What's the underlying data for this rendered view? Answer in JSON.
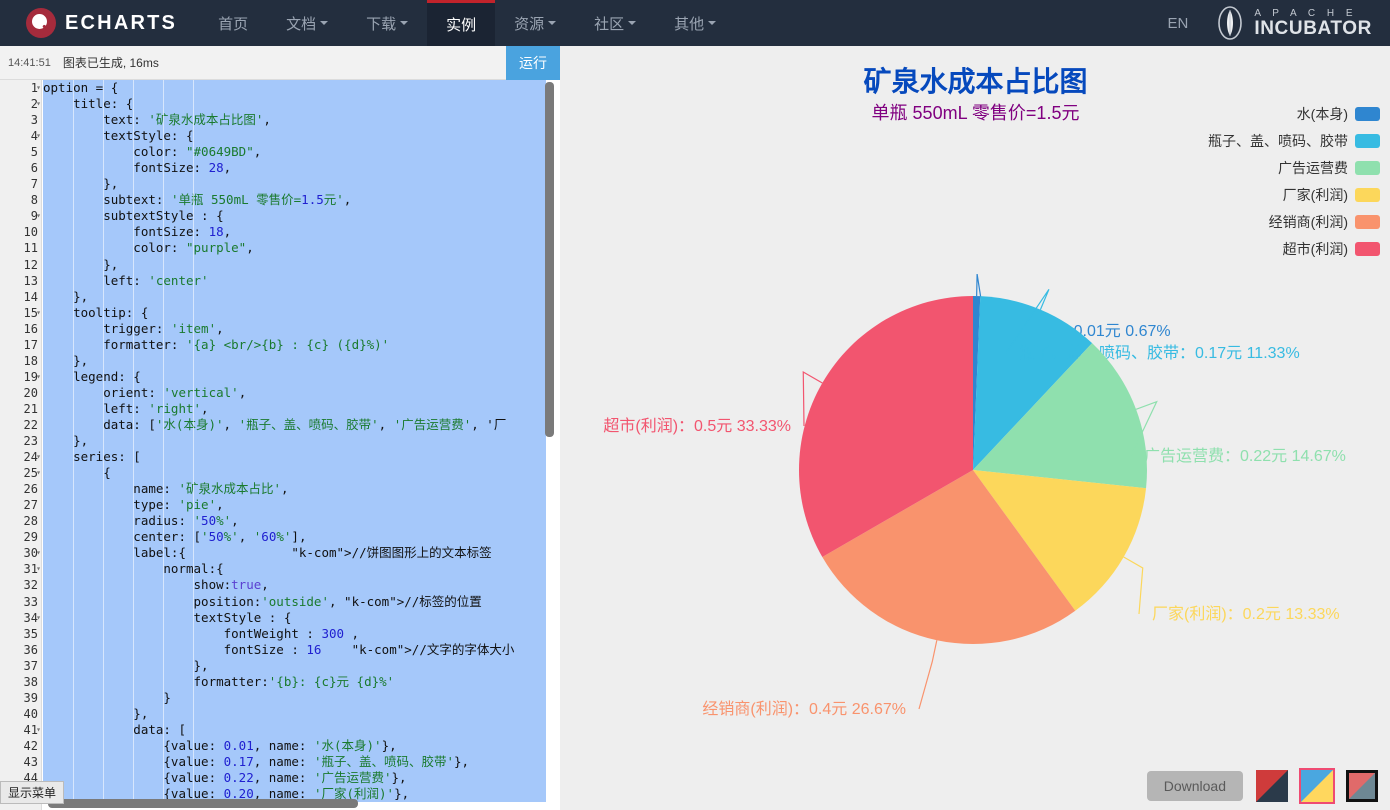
{
  "navbar": {
    "brand": "ECHARTS",
    "items": [
      {
        "label": "首页",
        "caret": false,
        "active": false
      },
      {
        "label": "文档",
        "caret": true,
        "active": false
      },
      {
        "label": "下载",
        "caret": true,
        "active": false
      },
      {
        "label": "实例",
        "caret": false,
        "active": true
      },
      {
        "label": "资源",
        "caret": true,
        "active": false
      },
      {
        "label": "社区",
        "caret": true,
        "active": false
      },
      {
        "label": "其他",
        "caret": true,
        "active": false
      }
    ],
    "lang": "EN",
    "incubator_top": "A P A C H E",
    "incubator_bottom": "INCUBATOR"
  },
  "editor": {
    "log_time": "14:41:51",
    "log_message": "图表已生成, 16ms",
    "run_label": "运行",
    "show_menu_label": "显示菜单",
    "first_line": 1,
    "fold_lines": [
      1,
      2,
      4,
      9,
      15,
      19,
      24,
      25,
      30,
      31,
      34,
      41
    ],
    "lines": [
      "option = {",
      "    title: {",
      "        text: '矿泉水成本占比图',",
      "        textStyle: {",
      "            color: \"#0649BD\",",
      "            fontSize: 28,",
      "        },",
      "        subtext: '单瓶 550mL 零售价=1.5元',",
      "        subtextStyle : {",
      "            fontSize: 18,",
      "            color: \"purple\",",
      "        },",
      "        left: 'center'",
      "    },",
      "    tooltip: {",
      "        trigger: 'item',",
      "        formatter: '{a} <br/>{b} : {c} ({d}%)'",
      "    },",
      "    legend: {",
      "        orient: 'vertical',",
      "        left: 'right',",
      "        data: ['水(本身)', '瓶子、盖、喷码、胶带', '广告运营费', '厂",
      "    },",
      "    series: [",
      "        {",
      "            name: '矿泉水成本占比',",
      "            type: 'pie',",
      "            radius: '50%',",
      "            center: ['50%', '60%'],",
      "            label:{              //饼图图形上的文本标签",
      "                normal:{",
      "                    show:true,",
      "                    position:'outside', //标签的位置",
      "                    textStyle : {",
      "                        fontWeight : 300 ,",
      "                        fontSize : 16    //文字的字体大小",
      "                    },",
      "                    formatter:'{b}: {c}元 {d}%'",
      "                }",
      "            },",
      "            data: [",
      "                {value: 0.01, name: '水(本身)'},",
      "                {value: 0.17, name: '瓶子、盖、喷码、胶带'},",
      "                {value: 0.22, name: '广告运营费'},",
      "                {value: 0.20, name: '厂家(利润)'},"
    ]
  },
  "chart_data": {
    "type": "pie",
    "title": "矿泉水成本占比图",
    "subtitle": "单瓶 550mL 零售价=1.5元",
    "title_color": "#0649BD",
    "subtitle_color": "#800080",
    "series_name": "矿泉水成本占比",
    "unit": "元",
    "total": 1.5,
    "legend_position": "right",
    "legend_orient": "vertical",
    "center": [
      "50%",
      "60%"
    ],
    "radius": "50%",
    "label_formatter": "{b}: {c}元 {d}%",
    "categories": [
      "水(本身)",
      "瓶子、盖、喷码、胶带",
      "广告运营费",
      "厂家(利润)",
      "经销商(利润)",
      "超市(利润)"
    ],
    "values": [
      0.01,
      0.17,
      0.22,
      0.2,
      0.4,
      0.5
    ],
    "percents": [
      "0.67%",
      "11.33%",
      "14.67%",
      "13.33%",
      "26.67%",
      "33.33%"
    ],
    "colors": [
      "#2f86d0",
      "#37bbe2",
      "#8fe0ae",
      "#fcd75b",
      "#f9936d",
      "#f2556f"
    ],
    "slices": [
      {
        "name": "水(本身)",
        "value": 0.01,
        "percent": "0.67%",
        "color": "#2f86d0",
        "label": "水(本身)：0.01元 0.67%"
      },
      {
        "name": "瓶子、盖、喷码、胶带",
        "value": 0.17,
        "percent": "11.33%",
        "color": "#37bbe2",
        "label": "瓶子、盖、喷码、胶带：0.17元 11.33%"
      },
      {
        "name": "广告运营费",
        "value": 0.22,
        "percent": "14.67%",
        "color": "#8fe0ae",
        "label": "广告运营费：0.22元 14.67%"
      },
      {
        "name": "厂家(利润)",
        "value": 0.2,
        "percent": "13.33%",
        "color": "#fcd75b",
        "label": "厂家(利润)：0.2元 13.33%"
      },
      {
        "name": "经销商(利润)",
        "value": 0.4,
        "percent": "26.67%",
        "color": "#f9936d",
        "label": "经销商(利润)：0.4元 26.67%"
      },
      {
        "name": "超市(利润)",
        "value": 0.5,
        "percent": "33.33%",
        "color": "#f2556f",
        "label": "超市(利润)：0.5元 33.33%"
      }
    ]
  },
  "legend": [
    {
      "label": "水(本身)",
      "color": "#2f86d0"
    },
    {
      "label": "瓶子、盖、喷码、胶带",
      "color": "#37bbe2"
    },
    {
      "label": "广告运营费",
      "color": "#8fe0ae"
    },
    {
      "label": "厂家(利润)",
      "color": "#fcd75b"
    },
    {
      "label": "经销商(利润)",
      "color": "#f9936d"
    },
    {
      "label": "超市(利润)",
      "color": "#f2556f"
    }
  ],
  "footer": {
    "download_label": "Download",
    "themes": [
      {
        "name": "theme-red-dark",
        "selected": false
      },
      {
        "name": "theme-blue-yellow",
        "selected": true
      },
      {
        "name": "theme-dark",
        "selected": false
      }
    ]
  }
}
